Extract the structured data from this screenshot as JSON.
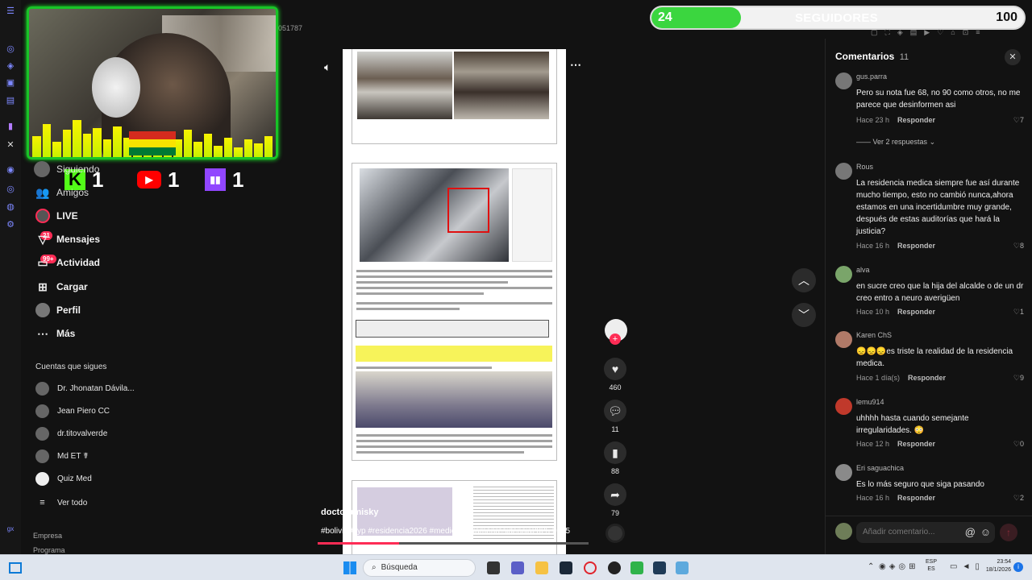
{
  "window": {
    "id_fragment": "051787"
  },
  "overlay": {
    "followers_current": "24",
    "followers_label": "SEGUIDORES",
    "followers_goal": "100",
    "followers_progress": 0.24,
    "kick_count": "1",
    "youtube_count": "1",
    "twitch_count": "1"
  },
  "sidebar": {
    "items": [
      {
        "label": "Siguiendo",
        "icon": "following-icon"
      },
      {
        "label": "Amigos",
        "icon": "friends-icon"
      },
      {
        "label": "LIVE",
        "icon": "live-icon"
      },
      {
        "label": "Mensajes",
        "icon": "messages-icon",
        "badge": "21"
      },
      {
        "label": "Actividad",
        "icon": "activity-icon",
        "badge": "99+"
      },
      {
        "label": "Cargar",
        "icon": "upload-icon"
      },
      {
        "label": "Perfil",
        "icon": "profile-icon"
      },
      {
        "label": "Más",
        "icon": "more-icon"
      }
    ],
    "following_title": "Cuentas que sigues",
    "following": [
      {
        "name": "Dr. Jhonatan Dávila..."
      },
      {
        "name": "Jean Piero CC"
      },
      {
        "name": "dr.titovalverde"
      },
      {
        "name": "Md ET ☤"
      },
      {
        "name": "Quiz Med"
      }
    ],
    "see_all": "Ver todo",
    "footer": [
      "Empresa",
      "Programa"
    ]
  },
  "video": {
    "author": "doctoramisky",
    "hashtags": "#bolivia #fyp #residencia2026 #medico #examenresidencia2025 2025",
    "likes": "460",
    "comments": "11",
    "saves": "88",
    "shares": "79",
    "progress": 0.3
  },
  "comments_panel": {
    "title": "Comentarios",
    "count": "11",
    "comments": [
      {
        "user": "gus.parra",
        "text": "Pero su nota fue 68, no 90 como otros, no me parece que desinformen asi",
        "time": "Hace 23 h",
        "reply": "Responder",
        "likes": "7",
        "replies": "Ver 2 respuestas"
      },
      {
        "user": "Rous",
        "text": "La residencia medica siempre fue así durante mucho tiempo, esto no cambió nunca,ahora estamos en una incertidumbre muy grande, después de estas auditorías que hará la justicia?",
        "time": "Hace 16 h",
        "reply": "Responder",
        "likes": "8"
      },
      {
        "user": "alva",
        "text": "en sucre creo que la hija del alcalde o de un dr creo entro a neuro averigüen",
        "time": "Hace 10 h",
        "reply": "Responder",
        "likes": "1"
      },
      {
        "user": "Karen ChS",
        "text": "😞😞😞es triste la realidad de la residencia medica.",
        "time": "Hace 1 día(s)",
        "reply": "Responder",
        "likes": "9"
      },
      {
        "user": "lemu914",
        "text": "uhhhh hasta cuando semejante irregularidades. 😳",
        "time": "Hace 12 h",
        "reply": "Responder",
        "likes": "0"
      },
      {
        "user": "Eri saguachica",
        "text": "Es lo más seguro que siga pasando",
        "time": "Hace 16 h",
        "reply": "Responder",
        "likes": "2"
      }
    ],
    "input_placeholder": "Añadir comentario..."
  },
  "taskbar": {
    "search_placeholder": "Búsqueda",
    "lang": "ESP",
    "lang2": "ES",
    "time": "23:54",
    "date": "18/1/2026"
  },
  "colors": {
    "accent_green": "#3bd63f",
    "tiktok_red": "#fe2c55"
  }
}
